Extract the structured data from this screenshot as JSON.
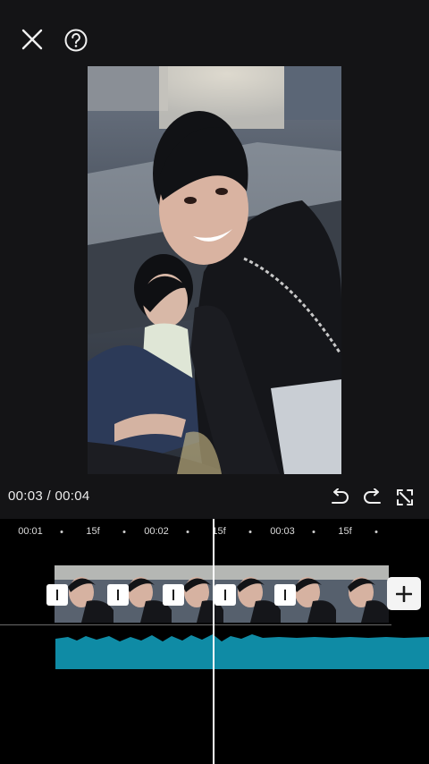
{
  "player": {
    "current_time": "00:03",
    "separator": "/",
    "duration": "00:04"
  },
  "ruler": {
    "labels": [
      "00:01",
      "15f",
      "00:02",
      "15f",
      "00:03",
      "15f"
    ]
  },
  "icons": {
    "close": "close-icon",
    "help": "help-icon",
    "undo": "undo-icon",
    "redo": "redo-icon",
    "fullscreen": "fullscreen-icon",
    "add": "plus-icon"
  },
  "colors": {
    "background": "#141416",
    "timeline_background": "#000000",
    "audio_waveform": "#0f8ba5",
    "playhead": "#ffffff",
    "add_button": "#f4f4f4"
  }
}
